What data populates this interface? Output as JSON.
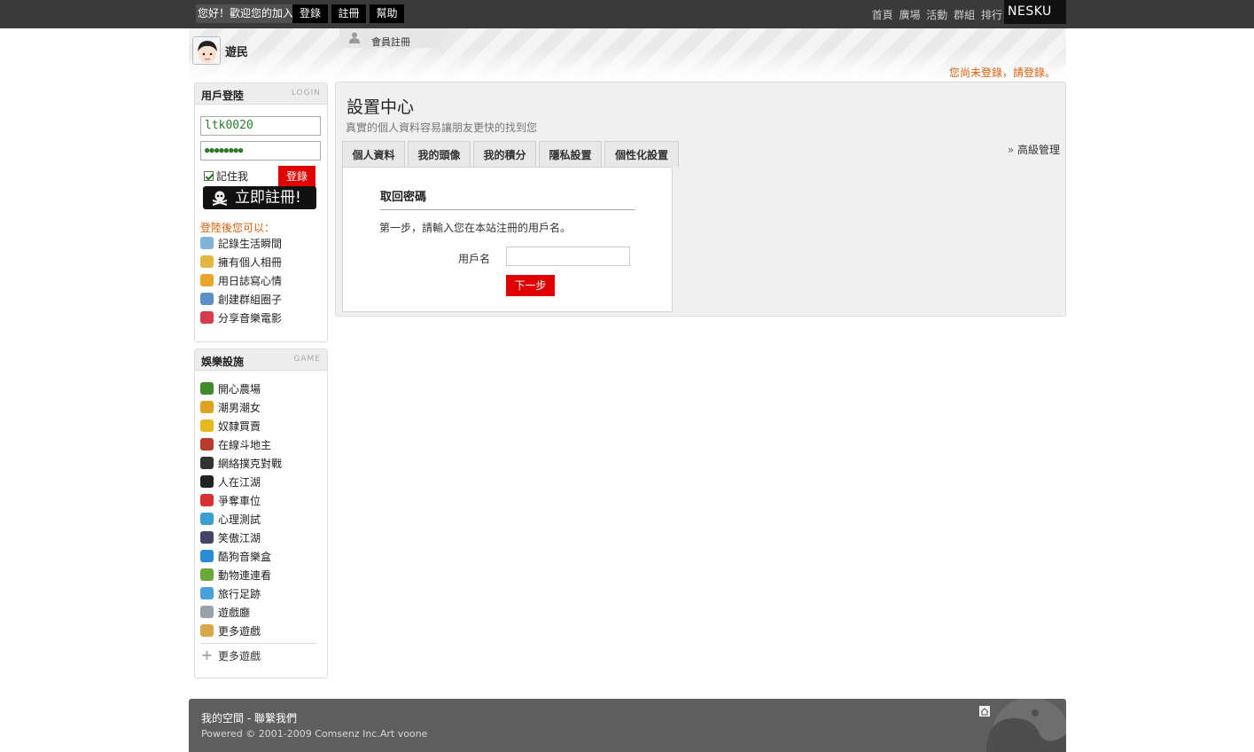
{
  "topbar": {
    "welcome": "您好！歡迎您的加入!",
    "login_label": "登錄",
    "register_label": "註冊",
    "help_label": "幫助",
    "nav": [
      "首頁",
      "廣場",
      "活動",
      "群組",
      "排行"
    ],
    "brand": "NESKU"
  },
  "header": {
    "username": "遊民",
    "tab_label": "會員註冊",
    "notice": "您尚未登錄，請登錄。"
  },
  "login_box": {
    "title": "用戶登陸",
    "title_en": "LOGIN",
    "username_value": "ltk0020",
    "password_value": "●●●●●●●●",
    "remember_label": "記住我",
    "login_button": "登錄",
    "register_button": "立即註冊!",
    "after_login_label": "登陸後您可以：",
    "features": [
      {
        "label": "記錄生活瞬間",
        "icon": "speech-bubble-icon",
        "color": "#7fb3d8"
      },
      {
        "label": "擁有個人相冊",
        "icon": "photo-icon",
        "color": "#e2b640"
      },
      {
        "label": "用日誌寫心情",
        "icon": "notebook-icon",
        "color": "#e9a52a"
      },
      {
        "label": "創建群組圈子",
        "icon": "people-icon",
        "color": "#5a8fc8"
      },
      {
        "label": "分享音樂電影",
        "icon": "heart-icon",
        "color": "#d83b4b"
      }
    ]
  },
  "game_box": {
    "title": "娛樂設施",
    "title_en": "GAME",
    "items": [
      {
        "label": "開心農場",
        "icon": "sprout-icon",
        "color": "#3f8a2a"
      },
      {
        "label": "潮男潮女",
        "icon": "couple-icon",
        "color": "#e0a020"
      },
      {
        "label": "奴隸買賣",
        "icon": "coins-icon",
        "color": "#e8b820"
      },
      {
        "label": "在線斗地主",
        "icon": "landlord-icon",
        "color": "#b83a2a"
      },
      {
        "label": "網絡撲克對戰",
        "icon": "poker-icon",
        "color": "#333333"
      },
      {
        "label": "人在江湖",
        "icon": "swordsman-icon",
        "color": "#222222"
      },
      {
        "label": "爭奪車位",
        "icon": "parking-icon",
        "color": "#d83030"
      },
      {
        "label": "心理測試",
        "icon": "flask-icon",
        "color": "#3aa0d0"
      },
      {
        "label": "笑傲江湖",
        "icon": "sword-icon",
        "color": "#444466"
      },
      {
        "label": "酷狗音樂盒",
        "icon": "music-icon",
        "color": "#2b8bd8"
      },
      {
        "label": "動物連連看",
        "icon": "animal-icon",
        "color": "#6aa83a"
      },
      {
        "label": "旅行足跡",
        "icon": "globe-icon",
        "color": "#4aa0d8"
      },
      {
        "label": "遊戲廳",
        "icon": "gamepad-icon",
        "color": "#9aa0a8"
      },
      {
        "label": "更多遊戲",
        "icon": "package-icon",
        "color": "#d8a848"
      }
    ],
    "more_label": "更多遊戲"
  },
  "main": {
    "title": "設置中心",
    "subtitle": "真實的個人資料容易讓朋友更快的找到您",
    "advanced_label": "高級管理",
    "tabs": [
      "個人資料",
      "我的頭像",
      "我的積分",
      "隱私設置",
      "個性化設置"
    ],
    "panel": {
      "title": "取回密碼",
      "step_text": "第一步，請輸入您在本站注冊的用戶名。",
      "username_label": "用戶名",
      "username_value": "",
      "next_button": "下一步"
    }
  },
  "footer": {
    "myspace_label": "我的空間",
    "separator": " - ",
    "contact_label": "聯繫我們",
    "powered": "Powered © 2001-2009 Comsenz Inc.Art voone"
  }
}
